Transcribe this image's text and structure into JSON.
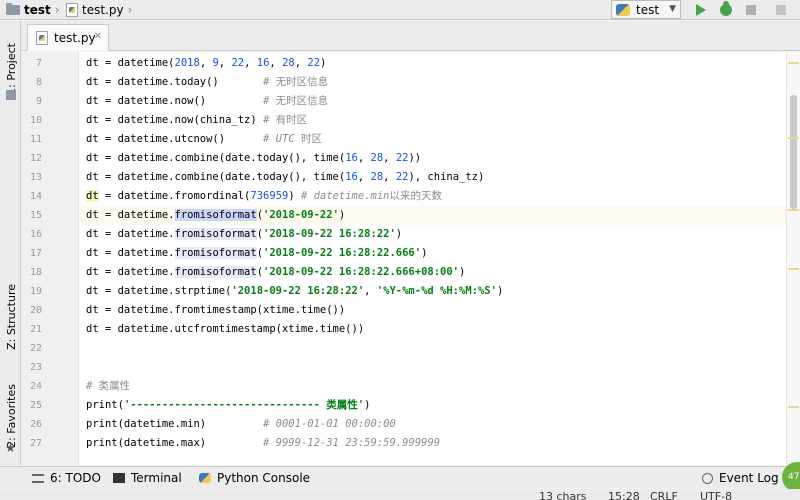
{
  "navbar": {
    "crumbs": [
      "test",
      "test.py"
    ],
    "run_config": "test"
  },
  "toolwindows": {
    "project": "1: Project",
    "structure": "Z: Structure",
    "favorites": "2: Favorites"
  },
  "editor": {
    "tab_label": "test.py",
    "lines": [
      {
        "n": "7",
        "html": "dt = datetime(<span class=\"tok-num\">2018</span>, <span class=\"tok-num\">9</span>, <span class=\"tok-num\">22</span>, <span class=\"tok-num\">16</span>, <span class=\"tok-num\">28</span>, <span class=\"tok-num\">22</span>)"
      },
      {
        "n": "8",
        "html": "dt = datetime.today()       <span class=\"tok-cmt-cn\"># 无时区信息</span>"
      },
      {
        "n": "9",
        "html": "dt = datetime.now()         <span class=\"tok-cmt-cn\"># 无时区信息</span>"
      },
      {
        "n": "10",
        "html": "dt = datetime.now(china_tz) <span class=\"tok-cmt-cn\"># 有时区</span>"
      },
      {
        "n": "11",
        "html": "dt = datetime.utcnow()      <span class=\"tok-cmt-cn\"># <i>UTC</i> 时区</span>"
      },
      {
        "n": "12",
        "html": "dt = datetime.combine(date.today(), time(<span class=\"tok-num\">16</span>, <span class=\"tok-num\">28</span>, <span class=\"tok-num\">22</span>))"
      },
      {
        "n": "13",
        "html": "dt = datetime.combine(date.today(), time(<span class=\"tok-num\">16</span>, <span class=\"tok-num\">28</span>, <span class=\"tok-num\">22</span>), china_tz)"
      },
      {
        "n": "14",
        "html": "<span class=\"tok-dt\">dt</span> = datetime.fromordinal(<span class=\"tok-num\">736959</span>) <span class=\"tok-cmt\"># datetime.min</span><span class=\"tok-cmt-cn\">以来的天数</span>"
      },
      {
        "n": "15",
        "html": "dt = datetime.<span class=\"tok-sel\">fromisoformat</span>(<span class=\"tok-str\">'2018-09-22'</span>)",
        "current": true
      },
      {
        "n": "16",
        "html": "dt = datetime.<span class=\"tok-hl\">fromisoformat</span>(<span class=\"tok-str\">'2018-09-22 16:28:22'</span>)"
      },
      {
        "n": "17",
        "html": "dt = datetime.<span class=\"tok-hl\">fromisoformat</span>(<span class=\"tok-str\">'2018-09-22 16:28:22.666'</span>)"
      },
      {
        "n": "18",
        "html": "dt = datetime.<span class=\"tok-hl\">fromisoformat</span>(<span class=\"tok-str\">'2018-09-22 16:28:22.666+08:00'</span>)"
      },
      {
        "n": "19",
        "html": "dt = datetime.strptime(<span class=\"tok-str\">'2018-09-22 16:28:22'</span>, <span class=\"tok-str\">'%Y-%m-%d %H:%M:%S'</span>)"
      },
      {
        "n": "20",
        "html": "dt = datetime.fromtimestamp(xtime.time())"
      },
      {
        "n": "21",
        "html": "dt = datetime.utcfromtimestamp(xtime.time())"
      },
      {
        "n": "22",
        "html": ""
      },
      {
        "n": "23",
        "html": ""
      },
      {
        "n": "24",
        "html": "<span class=\"tok-cmt-cn\"># 类属性</span>"
      },
      {
        "n": "25",
        "html": "print(<span class=\"tok-str\">'------------------------------ 类属性'</span>)"
      },
      {
        "n": "26",
        "html": "print(datetime.min)         <span class=\"tok-cmt\"># 0001-01-01 00:00:00</span>"
      },
      {
        "n": "27",
        "html": "print(datetime.max)         <span class=\"tok-cmt\"># 9999-12-31 23:59:59.999999</span>"
      }
    ]
  },
  "bottom_tabs": {
    "todo": "6: TODO",
    "terminal": "Terminal",
    "python_console": "Python Console",
    "event_log": "Event Log",
    "event_count": "47"
  },
  "status": {
    "selection": "13 chars",
    "position": "15:28",
    "line_sep": "CRLF",
    "encoding": "UTF-8"
  }
}
